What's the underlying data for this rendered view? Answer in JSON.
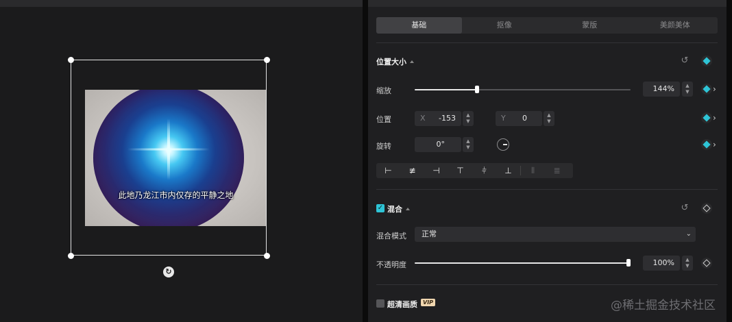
{
  "canvas": {
    "caption": "此地乃龙江市内仅存的平静之地",
    "rotate_icon": "↻"
  },
  "panel": {
    "tabs": [
      {
        "label": "基础",
        "active": true
      },
      {
        "label": "抠像",
        "active": false
      },
      {
        "label": "蒙版",
        "active": false
      },
      {
        "label": "美颜美体",
        "active": false
      }
    ],
    "position_size": {
      "title": "位置大小",
      "scale": {
        "label": "缩放",
        "value": "144%",
        "slider_fraction": 0.29
      },
      "position": {
        "label": "位置",
        "x_axis": "X",
        "x_value": "-153",
        "y_axis": "Y",
        "y_value": "0"
      },
      "rotation": {
        "label": "旋转",
        "value": "0°"
      },
      "align_icons": [
        "align-left-icon",
        "align-center-h-icon",
        "align-right-icon",
        "align-top-icon",
        "align-middle-v-icon",
        "align-bottom-icon",
        "distribute-h-icon",
        "distribute-v-icon"
      ]
    },
    "blend": {
      "title": "混合",
      "checked": true,
      "mode_label": "混合模式",
      "mode_value": "正常",
      "opacity_label": "不透明度",
      "opacity_value": "100%",
      "opacity_fraction": 1.0
    },
    "hd": {
      "title": "超清画质",
      "badge": "VIP",
      "checked": false
    }
  },
  "watermark": "@稀土掘金技术社区",
  "colors": {
    "accent": "#2ec4d6",
    "background": "#1b1b1c",
    "panel": "#1f1f21"
  }
}
